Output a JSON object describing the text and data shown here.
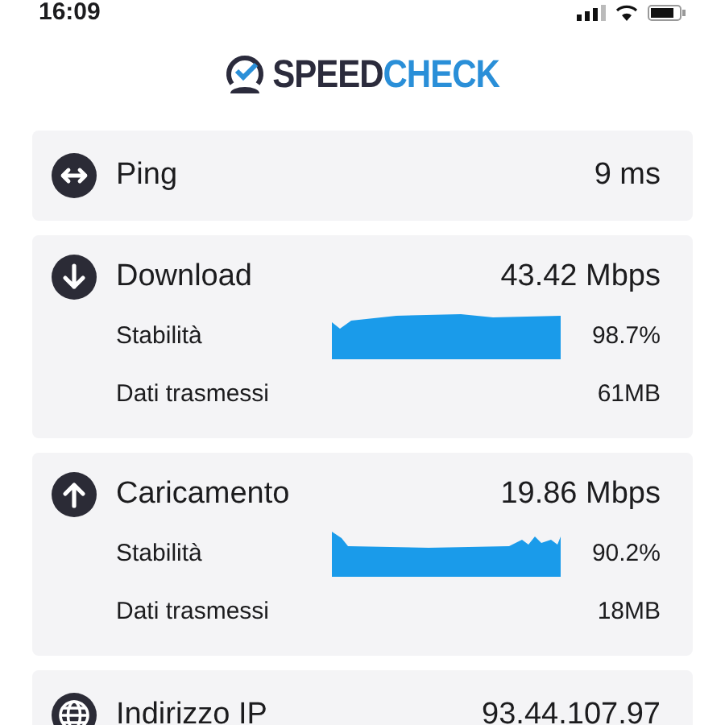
{
  "status_bar": {
    "time": "16:09"
  },
  "logo": {
    "part_1": "SPEED",
    "part_2": "CHECK"
  },
  "results": [
    {
      "kind": "ping",
      "label": "Ping",
      "value": "9 ms"
    },
    {
      "kind": "download",
      "label": "Download",
      "value": "43.42 Mbps",
      "details": [
        {
          "kind": "stability",
          "label": "Stabilità",
          "value": "98.7%"
        },
        {
          "kind": "data",
          "label": "Dati trasmessi",
          "value": "61MB"
        }
      ]
    },
    {
      "kind": "upload",
      "label": "Caricamento",
      "value": "19.86 Mbps",
      "details": [
        {
          "kind": "stability",
          "label": "Stabilità",
          "value": "90.2%"
        },
        {
          "kind": "data",
          "label": "Dati trasmessi",
          "value": "18MB"
        }
      ]
    },
    {
      "kind": "ip",
      "label": "Indirizzo IP",
      "value": "93.44.107.97"
    }
  ]
}
